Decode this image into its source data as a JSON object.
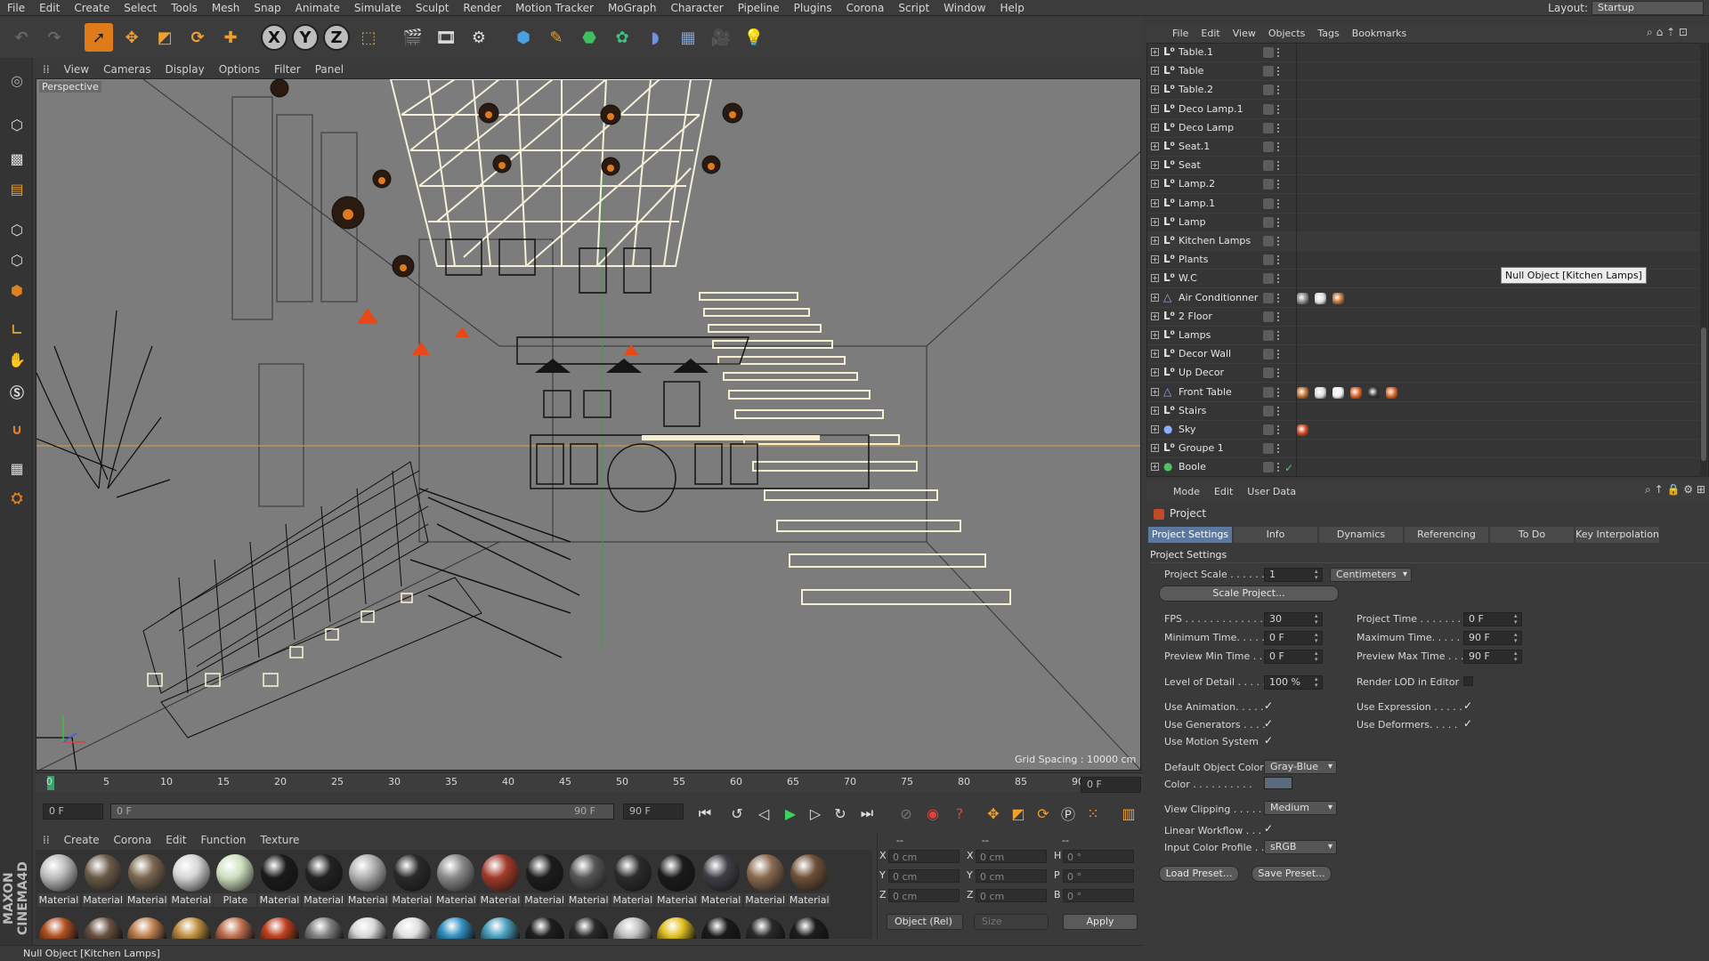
{
  "menu": [
    "File",
    "Edit",
    "Create",
    "Select",
    "Tools",
    "Mesh",
    "Snap",
    "Animate",
    "Simulate",
    "Sculpt",
    "Render",
    "Motion Tracker",
    "MoGraph",
    "Character",
    "Pipeline",
    "Plugins",
    "Corona",
    "Script",
    "Window",
    "Help"
  ],
  "layout": {
    "label": "Layout:",
    "value": "Startup"
  },
  "toolbar": {
    "axis_x": "X",
    "axis_y": "Y",
    "axis_z": "Z"
  },
  "viewport": {
    "menu": [
      "View",
      "Cameras",
      "Display",
      "Options",
      "Filter",
      "Panel"
    ],
    "label": "Perspective",
    "grid_spacing": "Grid Spacing : 10000 cm"
  },
  "timeline": {
    "ticks": [
      "0",
      "5",
      "10",
      "15",
      "20",
      "25",
      "30",
      "35",
      "40",
      "45",
      "50",
      "55",
      "60",
      "65",
      "70",
      "75",
      "80",
      "85",
      "90"
    ],
    "end_field": "0 F",
    "start_field": "0 F",
    "range_start": "0 F",
    "range_end": "90 F",
    "max_field": "90 F"
  },
  "materials": {
    "menu": [
      "Create",
      "Corona",
      "Edit",
      "Function",
      "Texture"
    ],
    "row1": [
      {
        "label": "Material",
        "color": "#bdbdbd"
      },
      {
        "label": "Material",
        "color": "#6a5a48"
      },
      {
        "label": "Material",
        "color": "#7a6650"
      },
      {
        "label": "Material",
        "color": "#d6d6d6"
      },
      {
        "label": "Plate",
        "color": "#cfe0c0"
      },
      {
        "label": "Material",
        "color": "#1a1a1a"
      },
      {
        "label": "Material",
        "color": "#222222"
      },
      {
        "label": "Material",
        "color": "#b0b0b0"
      },
      {
        "label": "Material",
        "color": "#2a2a2a"
      },
      {
        "label": "Material",
        "color": "#8a8a8a"
      },
      {
        "label": "Material",
        "color": "#a23a2a"
      },
      {
        "label": "Material",
        "color": "#1c1c1c"
      },
      {
        "label": "Material",
        "color": "#555555"
      },
      {
        "label": "Material",
        "color": "#2c2c2c"
      },
      {
        "label": "Material",
        "color": "#1a1a1a"
      },
      {
        "label": "Material",
        "color": "#3e3e46"
      },
      {
        "label": "Material",
        "color": "#8a6a50"
      },
      {
        "label": "Material",
        "color": "#6e5038"
      }
    ],
    "row2_colors": [
      "#b05020",
      "#6a5040",
      "#c08050",
      "#c09040",
      "#c07050",
      "#c04020",
      "#808080",
      "#d8d8d8",
      "#e0e0e0",
      "#3090c0",
      "#4aa0c0",
      "#1e1e1e",
      "#2a2a2a",
      "#c0c0c0",
      "#e0c020",
      "#1a1a1a",
      "#2a2a2a",
      "#1c1c1c"
    ]
  },
  "coordinates": {
    "header": [
      "--",
      "--",
      "--"
    ],
    "rows": [
      {
        "a": "X",
        "av": "0 cm",
        "b": "X",
        "bv": "0 cm",
        "c": "H",
        "cv": "0 °"
      },
      {
        "a": "Y",
        "av": "0 cm",
        "b": "Y",
        "bv": "0 cm",
        "c": "P",
        "cv": "0 °"
      },
      {
        "a": "Z",
        "av": "0 cm",
        "b": "Z",
        "bv": "0 cm",
        "c": "B",
        "cv": "0 °"
      }
    ],
    "mode": "Object (Rel)",
    "size": "Size",
    "apply": "Apply"
  },
  "status": "Null Object [Kitchen Lamps]",
  "objects": {
    "menu": [
      "File",
      "Edit",
      "View",
      "Objects",
      "Tags",
      "Bookmarks"
    ],
    "items": [
      {
        "name": "Table.1",
        "kind": "null",
        "tags": []
      },
      {
        "name": "Table",
        "kind": "null",
        "tags": []
      },
      {
        "name": "Table.2",
        "kind": "null",
        "tags": []
      },
      {
        "name": "Deco Lamp.1",
        "kind": "null",
        "tags": []
      },
      {
        "name": "Deco Lamp",
        "kind": "null",
        "tags": []
      },
      {
        "name": "Seat.1",
        "kind": "null",
        "tags": []
      },
      {
        "name": "Seat",
        "kind": "null",
        "tags": []
      },
      {
        "name": "Lamp.2",
        "kind": "null",
        "tags": []
      },
      {
        "name": "Lamp.1",
        "kind": "null",
        "tags": []
      },
      {
        "name": "Lamp",
        "kind": "null",
        "tags": []
      },
      {
        "name": "Kitchen Lamps",
        "kind": "null",
        "tags": []
      },
      {
        "name": "Plants",
        "kind": "null",
        "tags": []
      },
      {
        "name": "W.C",
        "kind": "null",
        "tags": []
      },
      {
        "name": "Air Conditionner",
        "kind": "mesh",
        "tags": [
          "#888",
          "#ddd",
          "#c07030"
        ]
      },
      {
        "name": "2 Floor",
        "kind": "null",
        "tags": []
      },
      {
        "name": "Lamps",
        "kind": "null",
        "tags": []
      },
      {
        "name": "Decor Wall",
        "kind": "null",
        "tags": []
      },
      {
        "name": "Up Decor",
        "kind": "null",
        "tags": []
      },
      {
        "name": "Front Table",
        "kind": "mesh",
        "tags": [
          "#c07030",
          "#ddd",
          "#eee",
          "#e06020",
          "#333",
          "#e06020"
        ]
      },
      {
        "name": "Stairs",
        "kind": "null",
        "tags": []
      },
      {
        "name": "Sky",
        "kind": "sky",
        "tags": [
          "#d04020"
        ]
      },
      {
        "name": "Groupe 1",
        "kind": "null",
        "tags": []
      },
      {
        "name": "Boole",
        "kind": "boole",
        "tags": []
      }
    ],
    "tooltip": "Null Object [Kitchen Lamps]"
  },
  "attributes": {
    "menu": [
      "Mode",
      "Edit",
      "User Data"
    ],
    "object": "Project",
    "tabs": [
      "Project Settings",
      "Info",
      "Dynamics",
      "Referencing",
      "To Do",
      "Key Interpolation"
    ],
    "section": "Project Settings",
    "project_scale": {
      "label": "Project Scale . . . . . .",
      "value": "1",
      "unit": "Centimeters"
    },
    "scale_button": "Scale Project...",
    "fps": {
      "label": "FPS . . . . . . . . . . . . . . .",
      "value": "30"
    },
    "project_time": {
      "label": "Project Time . . . . . . .",
      "value": "0 F"
    },
    "min_time": {
      "label": "Minimum Time. . . . . .",
      "value": "0 F"
    },
    "max_time": {
      "label": "Maximum Time. . . . . .",
      "value": "90 F"
    },
    "prev_min": {
      "label": "Preview Min Time . .",
      "value": "0 F"
    },
    "prev_max": {
      "label": "Preview Max Time . . .",
      "value": "90 F"
    },
    "lod": {
      "label": "Level of Detail . . . . .",
      "value": "100 %"
    },
    "render_lod": "Render LOD in Editor",
    "use_animation": "Use Animation. . . . .",
    "use_expression": "Use Expression . . . . .",
    "use_generators": "Use Generators . . . .",
    "use_deformers": "Use Deformers. . . . .",
    "use_motion": "Use Motion System",
    "default_color": {
      "label": "Default Object Color",
      "value": "Gray-Blue"
    },
    "color": {
      "label": "Color . . . . . . . . . .",
      "swatch": "#5a6a7a"
    },
    "view_clipping": {
      "label": "View Clipping . . . . .",
      "value": "Medium"
    },
    "linear_workflow": "Linear Workflow . . .",
    "input_profile": {
      "label": "Input Color Profile . .",
      "value": "sRGB"
    },
    "load_preset": "Load Preset...",
    "save_preset": "Save Preset...",
    "check": "✓"
  }
}
